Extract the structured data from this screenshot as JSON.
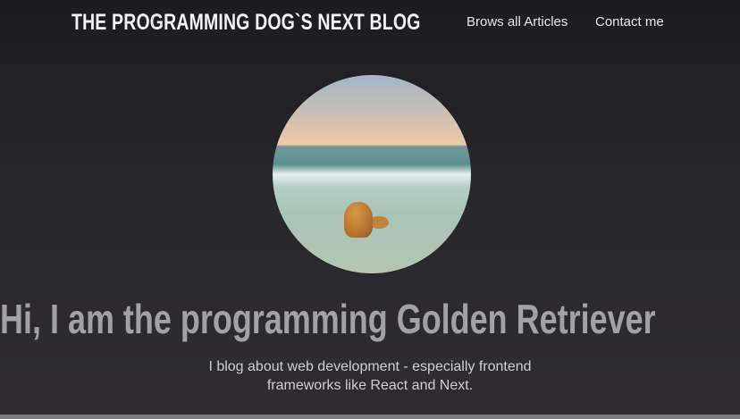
{
  "header": {
    "title": "THE PROGRAMMING DOG`S NEXT BLOG",
    "nav": [
      {
        "label": "Brows all Articles"
      },
      {
        "label": "Contact me"
      }
    ]
  },
  "hero": {
    "heading": "Hi, I am the programming Golden Retriever",
    "subtitle_line1": "I blog about web development - especially frontend",
    "subtitle_line2": "frameworks like React and Next."
  }
}
